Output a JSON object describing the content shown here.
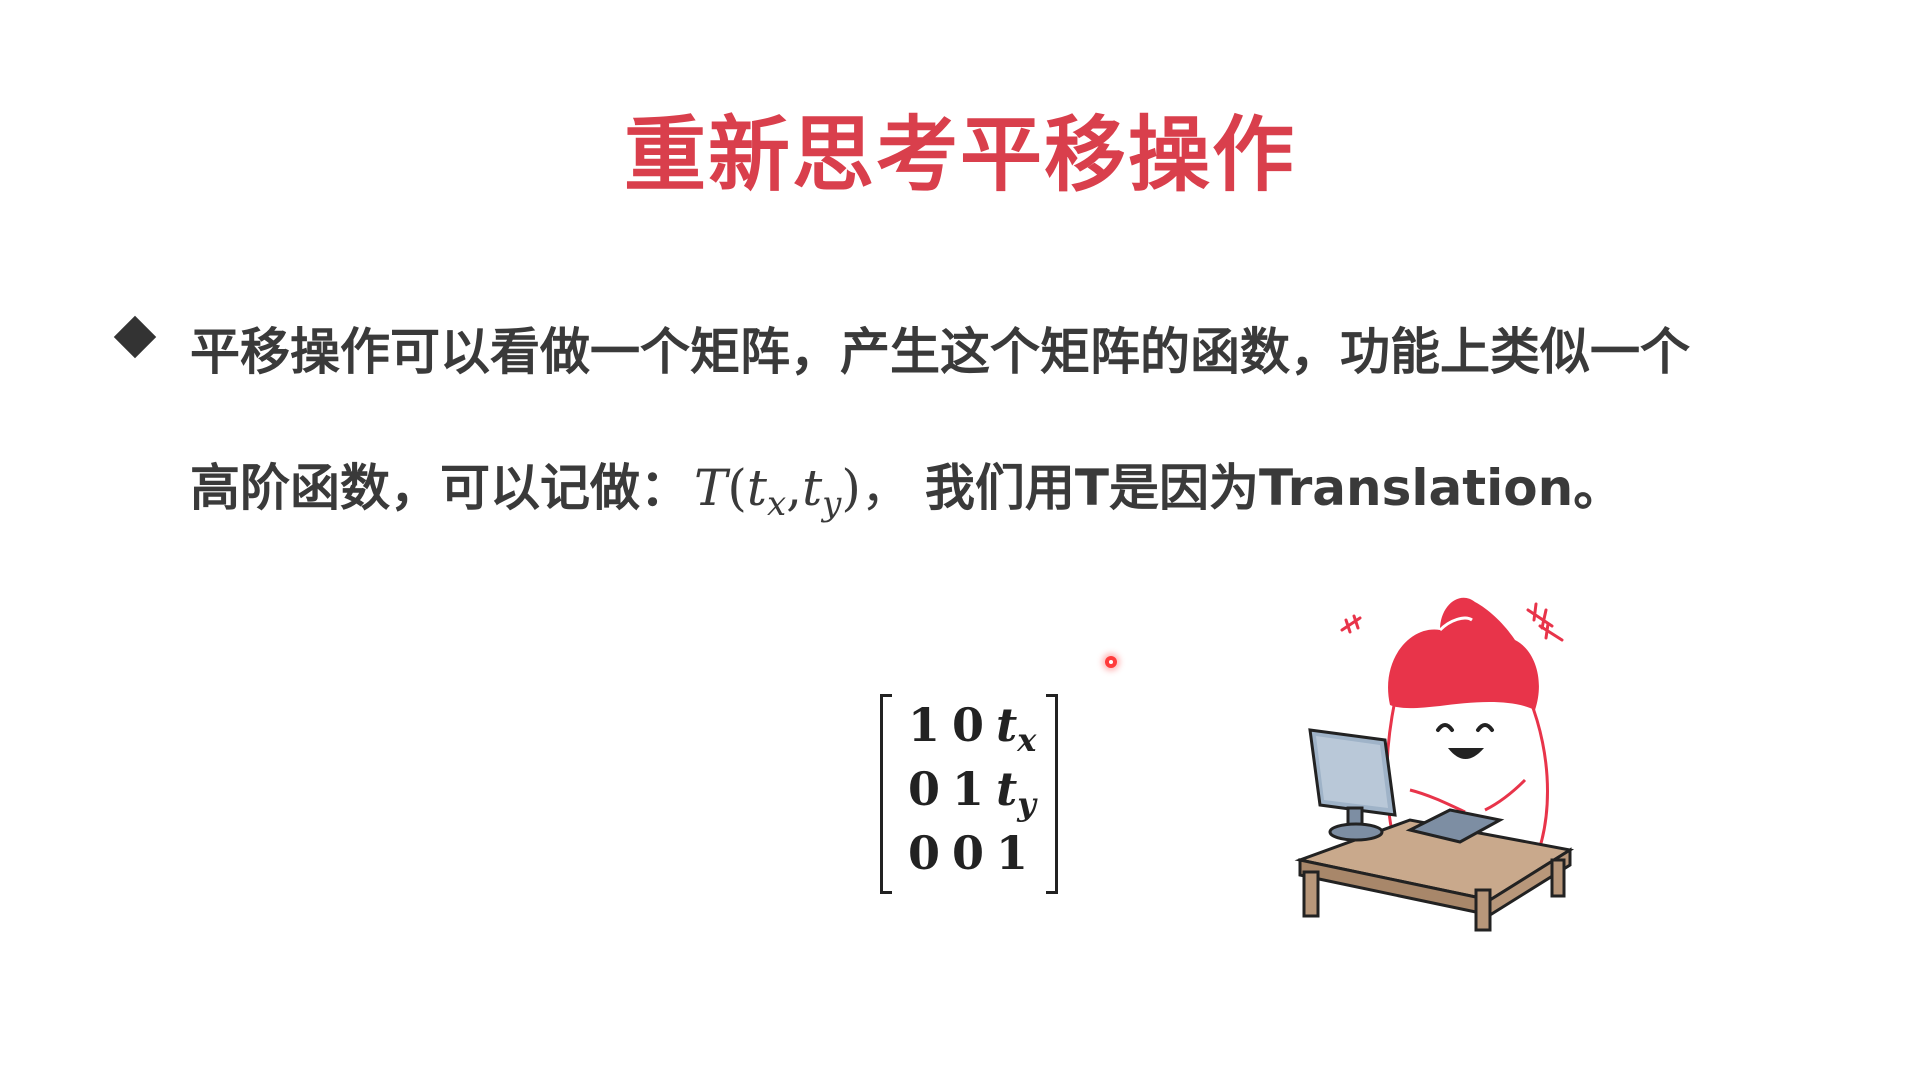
{
  "slide": {
    "title": "重新思考平移操作",
    "bullet": {
      "line1": "平移操作可以看做一个矩阵，产生这个矩阵的函数，功能上类似一个",
      "line2_prefix": "高阶函数，可以记做：",
      "formula": {
        "func": "T",
        "open": "(",
        "arg1": "t",
        "arg1_sub": "x",
        "comma": ",",
        "arg2": "t",
        "arg2_sub": "y",
        "close": ")",
        "trailing": "，"
      },
      "line2_suffix": "我们用T是因为Translation。"
    },
    "matrix": {
      "rows": [
        {
          "a": "1",
          "b": "0",
          "c": "t",
          "c_sub": "x"
        },
        {
          "a": "0",
          "b": "1",
          "c": "t",
          "c_sub": "y"
        },
        {
          "a": "0",
          "b": "0",
          "c": "1",
          "c_sub": ""
        }
      ]
    },
    "colors": {
      "title": "#d93f4c",
      "text": "#3a3a3a",
      "mascot_hair": "#e8344a",
      "pointer": "#ff3b3b"
    },
    "icons": [
      "diamond-bullet-icon",
      "laser-pointer-icon",
      "mascot-at-computer-illustration"
    ]
  }
}
